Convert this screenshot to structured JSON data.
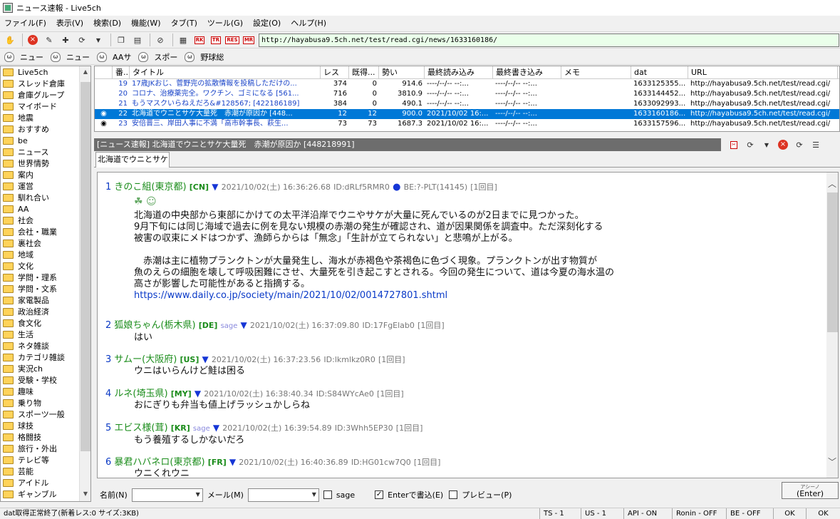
{
  "window": {
    "title": "ニュース速報 - Live5ch"
  },
  "menu": [
    "ファイル(F)",
    "表示(V)",
    "検索(D)",
    "機能(W)",
    "タブ(T)",
    "ツール(G)",
    "設定(O)",
    "ヘルプ(H)"
  ],
  "url": "http://hayabusa9.5ch.net/test/read.cgi/news/1633160186/",
  "boards": [
    "ニュー",
    "ニュー",
    "AAサ",
    "スポー",
    "野球総"
  ],
  "tree": [
    "Live5ch",
    "スレッド倉庫",
    "倉庫グループ",
    "マイボード",
    "地震",
    "おすすめ",
    "be",
    "ニュース",
    "世界情勢",
    "案内",
    "運営",
    "馴れ合い",
    "AA",
    "社会",
    "会社・職業",
    "裏社会",
    "地域",
    "文化",
    "学問・理系",
    "学問・文系",
    "家電製品",
    "政治経済",
    "食文化",
    "生活",
    "ネタ雑談",
    "カテゴリ雑談",
    "実況ch",
    "受験・学校",
    "趣味",
    "乗り物",
    "スポーツ一般",
    "球技",
    "格闘技",
    "旅行・外出",
    "テレビ等",
    "芸能",
    "アイドル",
    "ギャンブル",
    "ゲーム"
  ],
  "threadlist": {
    "columns": [
      "番...",
      "タイトル",
      "レス",
      "既得...",
      "勢い",
      "最終読み込み",
      "最終書き込み",
      "メモ",
      "dat",
      "URL"
    ],
    "rows": [
      {
        "num": "19",
        "title": "17歳JKおじ、菅野完の拡散情報を投稿しただけの...",
        "res": "374",
        "got": "0",
        "ikioi": "914.6",
        "lastread": "----/--/-- --:...",
        "lastwrite": "----/--/-- --:...",
        "memo": "",
        "dat": "1633125355...",
        "url": "http://hayabusa9.5ch.net/test/read.cgi/",
        "titleColor": "#1a44c8",
        "selected": false
      },
      {
        "num": "20",
        "title": "コロナ、治療薬完全。ワクチン、ゴミになる [561...",
        "res": "716",
        "got": "0",
        "ikioi": "3810.9",
        "lastread": "----/--/-- --:...",
        "lastwrite": "----/--/-- --:...",
        "memo": "",
        "dat": "1633144452...",
        "url": "http://hayabusa9.5ch.net/test/read.cgi/",
        "titleColor": "#1a44c8",
        "selected": false
      },
      {
        "num": "21",
        "title": "もうマスクいらねえだろ&#128567; [422186189]",
        "res": "384",
        "got": "0",
        "ikioi": "490.1",
        "lastread": "----/--/-- --:...",
        "lastwrite": "----/--/-- --:...",
        "memo": "",
        "dat": "1633092993...",
        "url": "http://hayabusa9.5ch.net/test/read.cgi/",
        "titleColor": "#1a44c8",
        "selected": false
      },
      {
        "num": "22",
        "title": "北海道でウニとサケ大量死　赤潮が原因か [448...",
        "res": "12",
        "got": "12",
        "ikioi": "900.0",
        "lastread": "2021/10/02 16:...",
        "lastwrite": "----/--/-- --:...",
        "memo": "",
        "dat": "1633160186...",
        "url": "http://hayabusa9.5ch.net/test/read.cgi/",
        "titleColor": "#ffffff",
        "selected": true
      },
      {
        "num": "23",
        "title": "安倍晋三、岸田人事に不満「高市幹事長、萩生...",
        "res": "73",
        "got": "73",
        "ikioi": "1687.3",
        "lastread": "2021/10/02 16:...",
        "lastwrite": "----/--/-- --:...",
        "memo": "",
        "dat": "1633157596...",
        "url": "http://hayabusa9.5ch.net/test/read.cgi/",
        "titleColor": "#1a44c8",
        "selected": false
      }
    ]
  },
  "view": {
    "title": "[ニュース速報] 北海道でウニとサケ大量死　赤潮が原因か [448218991]",
    "tab": "北海道でウニとサケ",
    "posts": [
      {
        "num": "1",
        "name": "きのこ組(東京都)",
        "cc": "[CN]",
        "sage": "",
        "date": "2021/10/02(土) 16:36:26.68",
        "id": "ID:dRLf5RMR0",
        "extra": "BE:?-PLT(14145)",
        "count": "[1回目]",
        "body": [
          "北海道の中央部から東部にかけての太平洋沿岸でウニやサケが大量に死んでいるのが2日までに見つかった。",
          "9月下旬には同じ海域で過去に例を見ない規模の赤潮の発生が確認され、道が因果関係を調査中。ただ深刻化する",
          "被害の収束にメドはつかず、漁師らからは「無念」「生計が立てられない」と悲鳴が上がる。",
          "",
          "　赤潮は主に植物プランクトンが大量発生し、海水が赤褐色や茶褐色に色づく現象。プランクトンが出す物質が",
          "魚のえらの細胞を壊して呼吸困難にさせ、大量死を引き起こすとされる。今回の発生について、道は今夏の海水温の",
          "高さが影響した可能性があると指摘する。"
        ],
        "link": "https://www.daily.co.jp/society/main/2021/10/02/0014727801.shtml"
      },
      {
        "num": "2",
        "name": "狐娘ちゃん(栃木県)",
        "cc": "[DE]",
        "sage": "sage",
        "date": "2021/10/02(土) 16:37:09.80",
        "id": "ID:17FgElab0",
        "extra": "",
        "count": "[1回目]",
        "body": [
          "はい"
        ],
        "link": ""
      },
      {
        "num": "3",
        "name": "サムー(大阪府)",
        "cc": "[US]",
        "sage": "",
        "date": "2021/10/02(土) 16:37:23.56",
        "id": "ID:lkmlkz0R0",
        "extra": "",
        "count": "[1回目]",
        "body": [
          "ウニはいらんけど鮭は困る"
        ],
        "link": ""
      },
      {
        "num": "4",
        "name": "ルネ(埼玉県)",
        "cc": "[MY]",
        "sage": "",
        "date": "2021/10/02(土) 16:38:40.34",
        "id": "ID:S84WYcAe0",
        "extra": "",
        "count": "[1回目]",
        "body": [
          "おにぎりも弁当も値上げラッシュかしらね"
        ],
        "link": ""
      },
      {
        "num": "5",
        "name": "エビス様(茸)",
        "cc": "[KR]",
        "sage": "sage",
        "date": "2021/10/02(土) 16:39:54.89",
        "id": "ID:3Whh5EP30",
        "extra": "",
        "count": "[1回目]",
        "body": [
          "もう養殖するしかないだろ"
        ],
        "link": ""
      },
      {
        "num": "6",
        "name": "暴君ハバネロ(東京都)",
        "cc": "[FR]",
        "sage": "",
        "date": "2021/10/02(土) 16:40:36.89",
        "id": "ID:HG01cw7Q0",
        "extra": "",
        "count": "[1回目]",
        "body": [
          "ウニくれウニ"
        ],
        "link": ""
      }
    ]
  },
  "write": {
    "name_label": "名前(N)",
    "mail_label": "メール(M)",
    "sage_label": "sage",
    "enter_label": "Enterで書込(E)",
    "preview_label": "プレビュー(P)",
    "button_top": "アシーノ",
    "button_label": "(Enter)"
  },
  "status": {
    "main": "dat取得正常終了(新着レス:0 サイズ:3KB)",
    "ts": "TS - 1",
    "us": "US - 1",
    "api": "API - ON",
    "ronin": "Ronin - OFF",
    "be": "BE - OFF",
    "ok1": "OK",
    "ok2": "OK"
  }
}
